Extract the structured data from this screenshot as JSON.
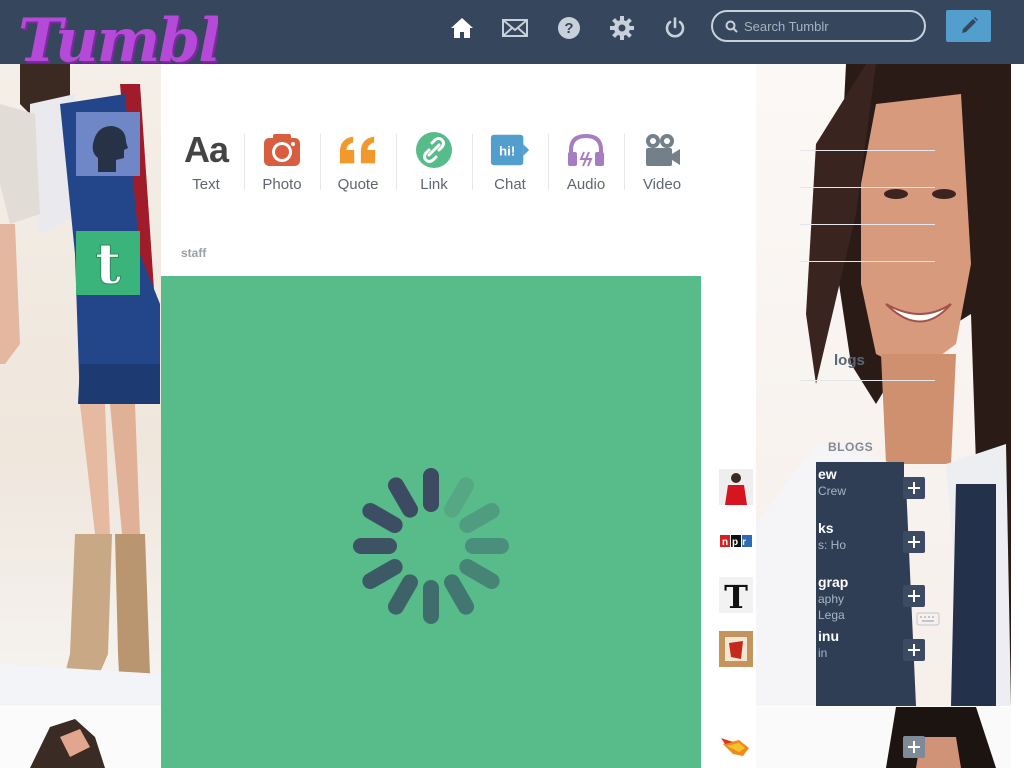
{
  "header": {
    "logo_text": "Tumblr",
    "search_placeholder": "Search Tumblr",
    "nav_icons": [
      "home-icon",
      "mail-icon",
      "help-icon",
      "gear-icon",
      "power-icon"
    ],
    "compose_icon": "pencil-icon"
  },
  "post_types": [
    {
      "label": "Text",
      "icon": "text-icon",
      "color": "#444444"
    },
    {
      "label": "Photo",
      "icon": "camera-icon",
      "color": "#d95e40"
    },
    {
      "label": "Quote",
      "icon": "quote-icon",
      "color": "#f2992e"
    },
    {
      "label": "Link",
      "icon": "link-icon",
      "color": "#56bc8a"
    },
    {
      "label": "Chat",
      "icon": "chat-icon",
      "color": "#529ecc",
      "icon_text": "hi!"
    },
    {
      "label": "Audio",
      "icon": "headphones-icon",
      "color": "#a77dc2"
    },
    {
      "label": "Video",
      "icon": "video-camera-icon",
      "color": "#748089"
    }
  ],
  "post": {
    "author": "staff",
    "card_color": "#58bb8a"
  },
  "sidebar": {
    "blogs_header": "logs",
    "recommended_header": "BLOGS",
    "recommended": [
      {
        "name": "ew",
        "sub": "Crew",
        "avatar": "red-figure"
      },
      {
        "name": "ks",
        "sub": "s: Ho",
        "avatar": "npr-logo",
        "avatar_text": "npr"
      },
      {
        "name": "grap",
        "sub": "aphy",
        "sub2": "Lega",
        "avatar": "t-logo",
        "avatar_text": "T"
      },
      {
        "name": "inu",
        "sub": "in",
        "avatar": "red-square"
      }
    ]
  },
  "colors": {
    "navbar": "#36465d",
    "compose": "#529ecc",
    "post_card": "#58bb8a",
    "logo": "#b64ad8"
  }
}
